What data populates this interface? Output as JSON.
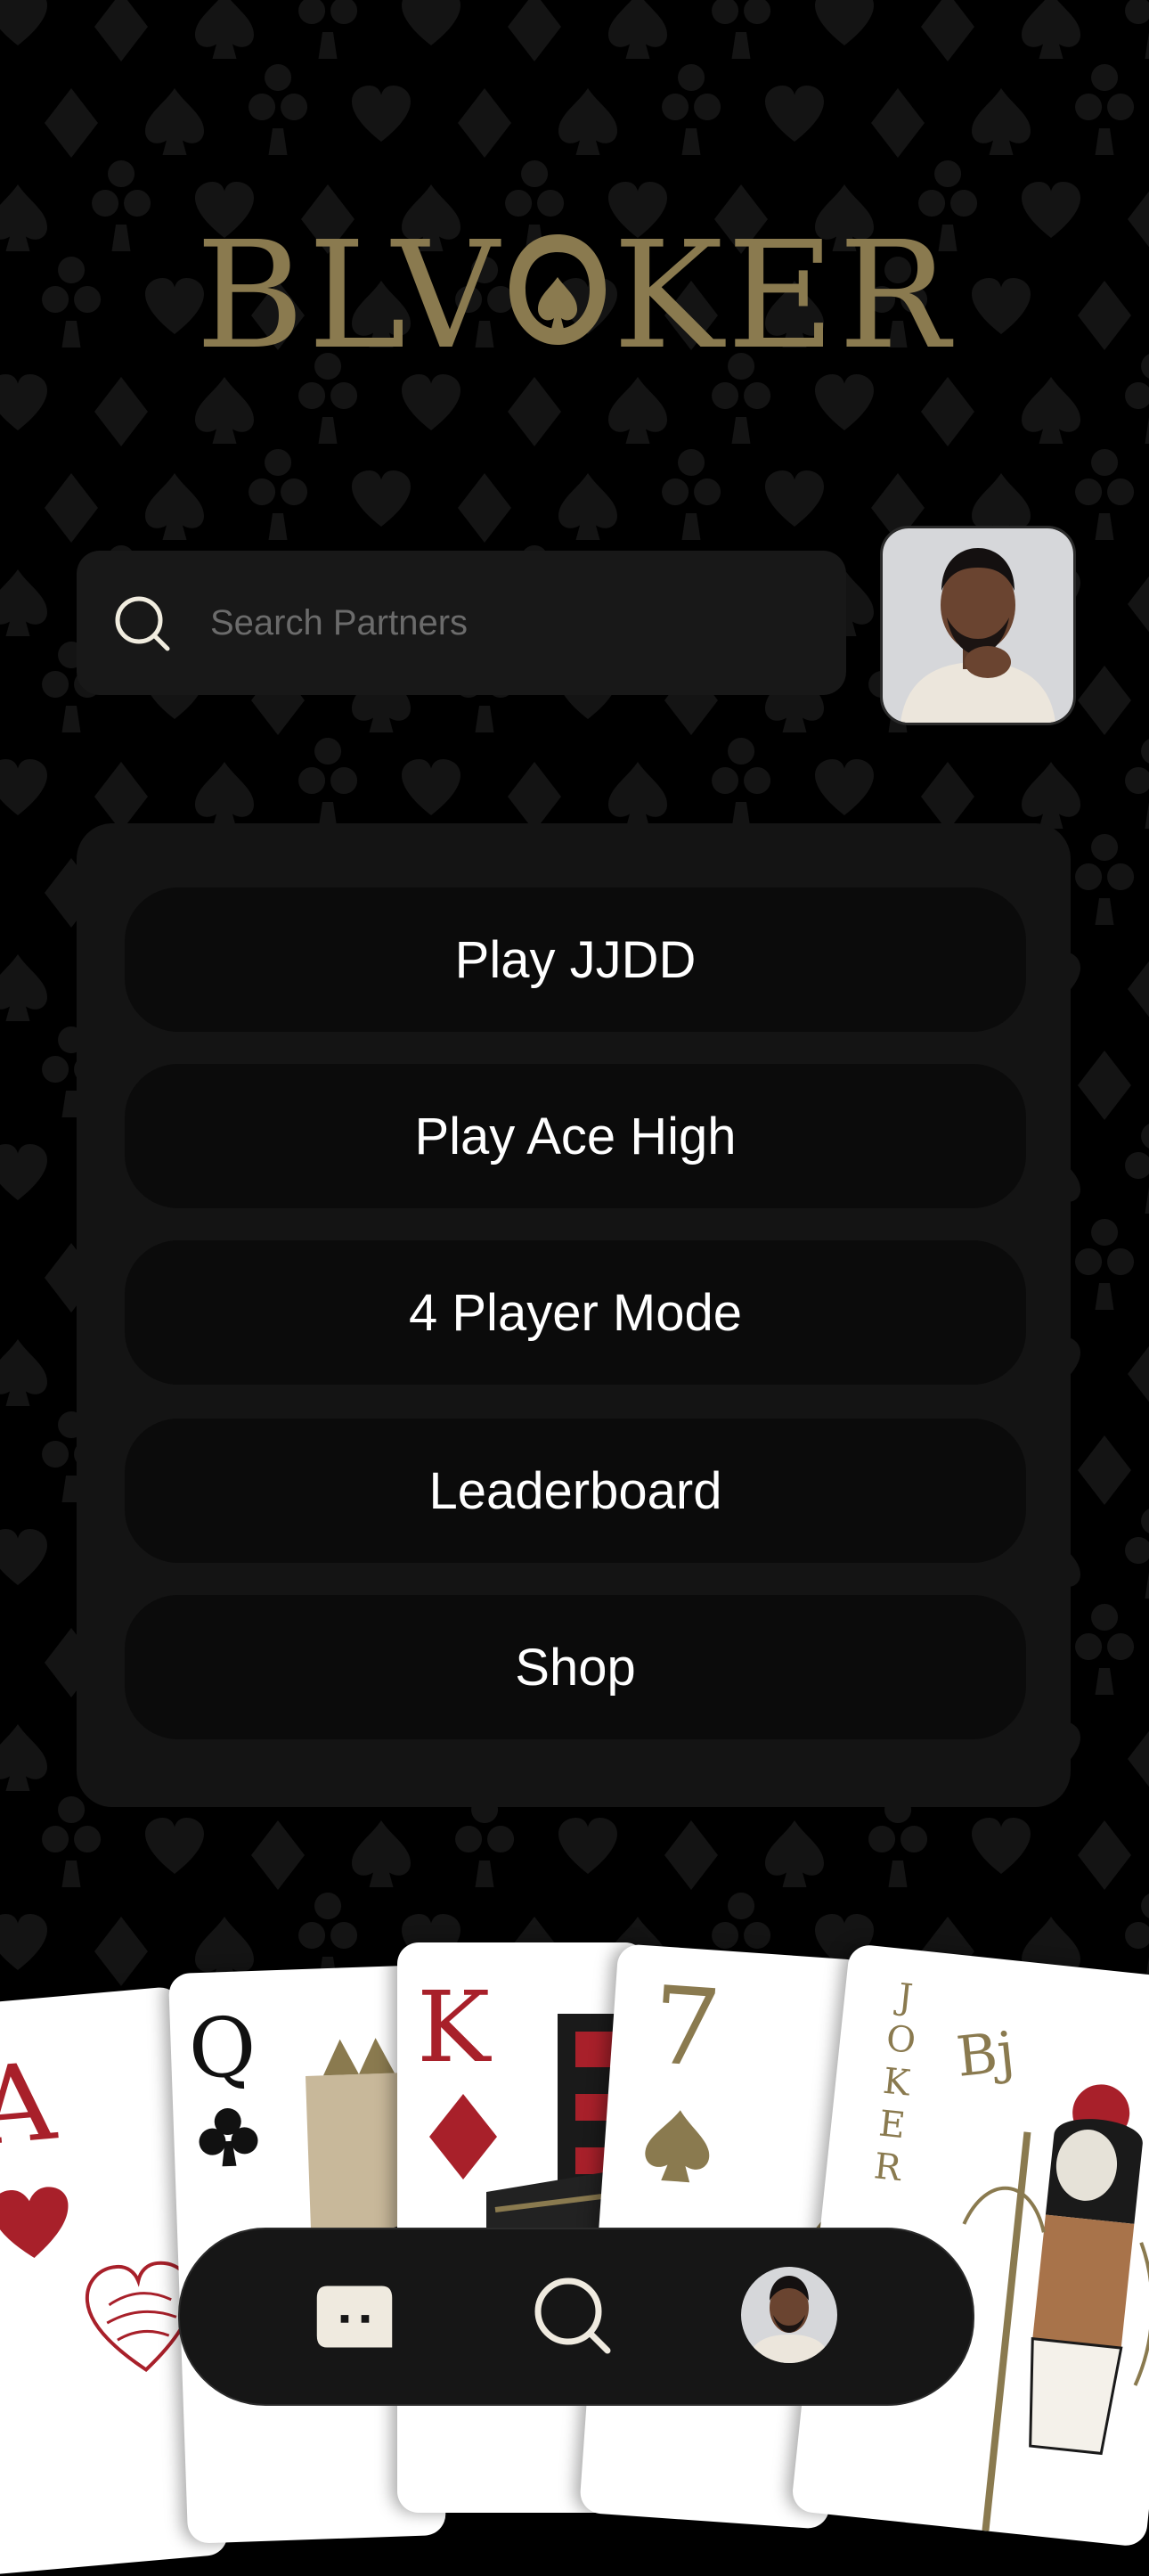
{
  "app": {
    "logo_text": "BLVCKER"
  },
  "search": {
    "placeholder": "Search Partners",
    "value": ""
  },
  "menu": {
    "items": [
      {
        "label": "Play JJDD"
      },
      {
        "label": "Play Ace High"
      },
      {
        "label": "4 Player Mode"
      },
      {
        "label": "Leaderboard"
      },
      {
        "label": "Shop"
      }
    ]
  },
  "cards": [
    {
      "rank": "A",
      "suit": "heart",
      "color": "#a8202a"
    },
    {
      "rank": "Q",
      "suit": "club",
      "color": "#111111"
    },
    {
      "rank": "K",
      "suit": "diamond",
      "color": "#a8202a"
    },
    {
      "rank": "7",
      "suit": "spade",
      "color": "#8a7a4f"
    },
    {
      "rank": "JOKER",
      "suit": "joker",
      "color": "#8a7a4f"
    }
  ],
  "nav": {
    "items": [
      {
        "name": "chat-icon"
      },
      {
        "name": "search-icon"
      },
      {
        "name": "profile-avatar"
      }
    ]
  },
  "colors": {
    "gold": "#8a7a4f",
    "background": "#000000",
    "panel": "#141414",
    "button": "#0b0b0b",
    "red": "#a8202a"
  }
}
